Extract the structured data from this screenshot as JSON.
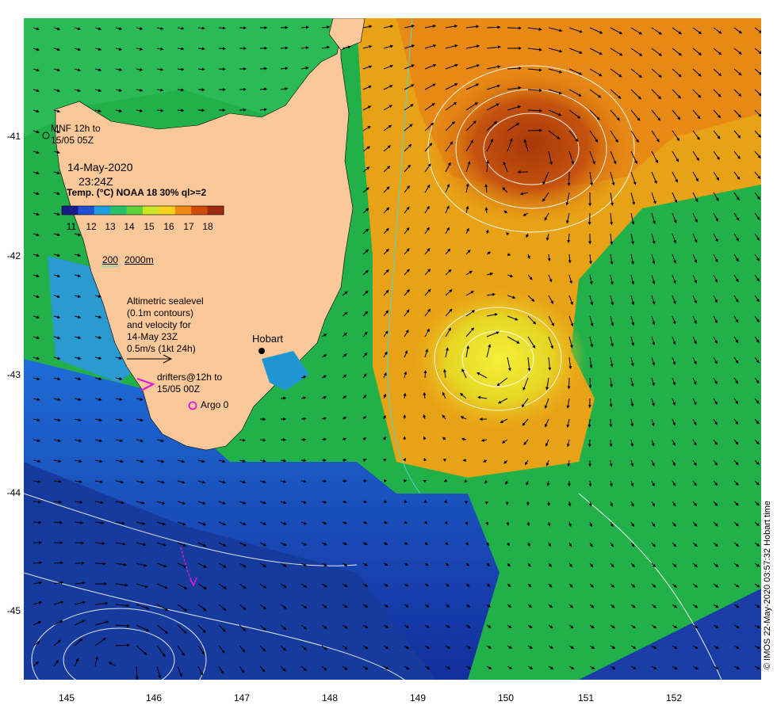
{
  "map": {
    "date_line1": "14-May-2020",
    "date_line2": "23:24Z",
    "sensor_label": "Temp. (°C) NOAA 18 30% ql>=2",
    "colorbar_ticks": [
      "11",
      "12",
      "13",
      "14",
      "15",
      "16",
      "17",
      "18"
    ],
    "colorbar_colors": [
      "#1a1a8c",
      "#1f50d6",
      "#1fa0e0",
      "#27c36b",
      "#5dd23a",
      "#c8e626",
      "#f3d21c",
      "#f08a12",
      "#d14a0a",
      "#9c2a0c"
    ],
    "bathy_label_200": "200",
    "bathy_label_2000": "2000m",
    "mnf_line1": "MNF 12h to",
    "mnf_line2": "15/05 05Z",
    "altimetry_lines": [
      "Altimetric sealevel",
      "(0.1m contours)",
      "and velocity for",
      "14-May 23Z",
      "0.5m/s (1kt 24h)"
    ],
    "drifters_line1": "drifters@12h to",
    "drifters_line2": "15/05 00Z",
    "argo_label": "Argo 0",
    "city_label": "Hobart",
    "credit": "© IMOS 22-May-2020 03:57:32 Hobart time",
    "x_ticks": [
      "145",
      "146",
      "147",
      "148",
      "149",
      "150",
      "151",
      "152"
    ],
    "y_ticks": [
      "-41",
      "-42",
      "-43",
      "-44",
      "-45"
    ],
    "colors": {
      "land": "#fbc89a",
      "drifter": "#e01ad8",
      "vector": "#000000",
      "contour": "#ffffff"
    }
  }
}
